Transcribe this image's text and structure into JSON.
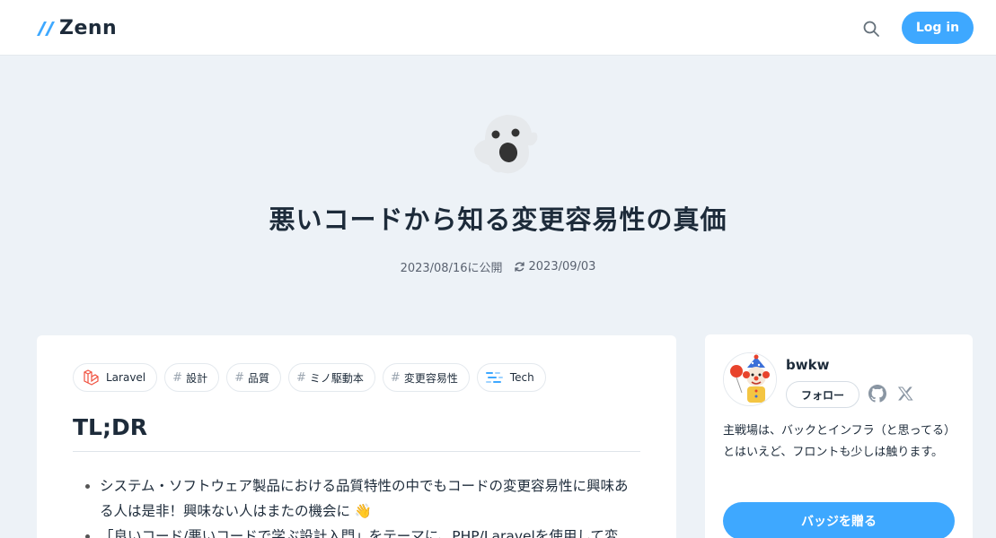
{
  "header": {
    "logo_text": "Zenn",
    "login_label": "Log in"
  },
  "article": {
    "emoji": "ghost",
    "title": "悪いコードから知る変更容易性の真価",
    "published": "2023/08/16に公開",
    "updated": "2023/09/03",
    "topics": [
      {
        "label": "Laravel",
        "icon": "laravel-icon"
      },
      {
        "label": "設計",
        "icon": "hash"
      },
      {
        "label": "品質",
        "icon": "hash"
      },
      {
        "label": "ミノ駆動本",
        "icon": "hash"
      },
      {
        "label": "変更容易性",
        "icon": "hash"
      },
      {
        "label": "Tech",
        "icon": "tech-icon"
      }
    ],
    "section_heading": "TL;DR",
    "bullets": [
      "システム・ソフトウェア製品における品質特性の中でもコードの変更容易性に興味ある人は是非！興味ない人はまたの機会に 👋",
      "「良いコード/悪いコードで学ぶ設計入門」をテーマに、PHP/Laravelを使用して変"
    ]
  },
  "author": {
    "name": "bwkw",
    "follow_label": "フォロー",
    "bio": "主戦場は、バックとインフラ（と思ってる）とはいえど、フロントも少しは触ります。",
    "badge_label": "バッジを贈る"
  },
  "colors": {
    "accent": "#3ea8ff",
    "background": "#edf2f7",
    "text": "#1d2b3a"
  }
}
